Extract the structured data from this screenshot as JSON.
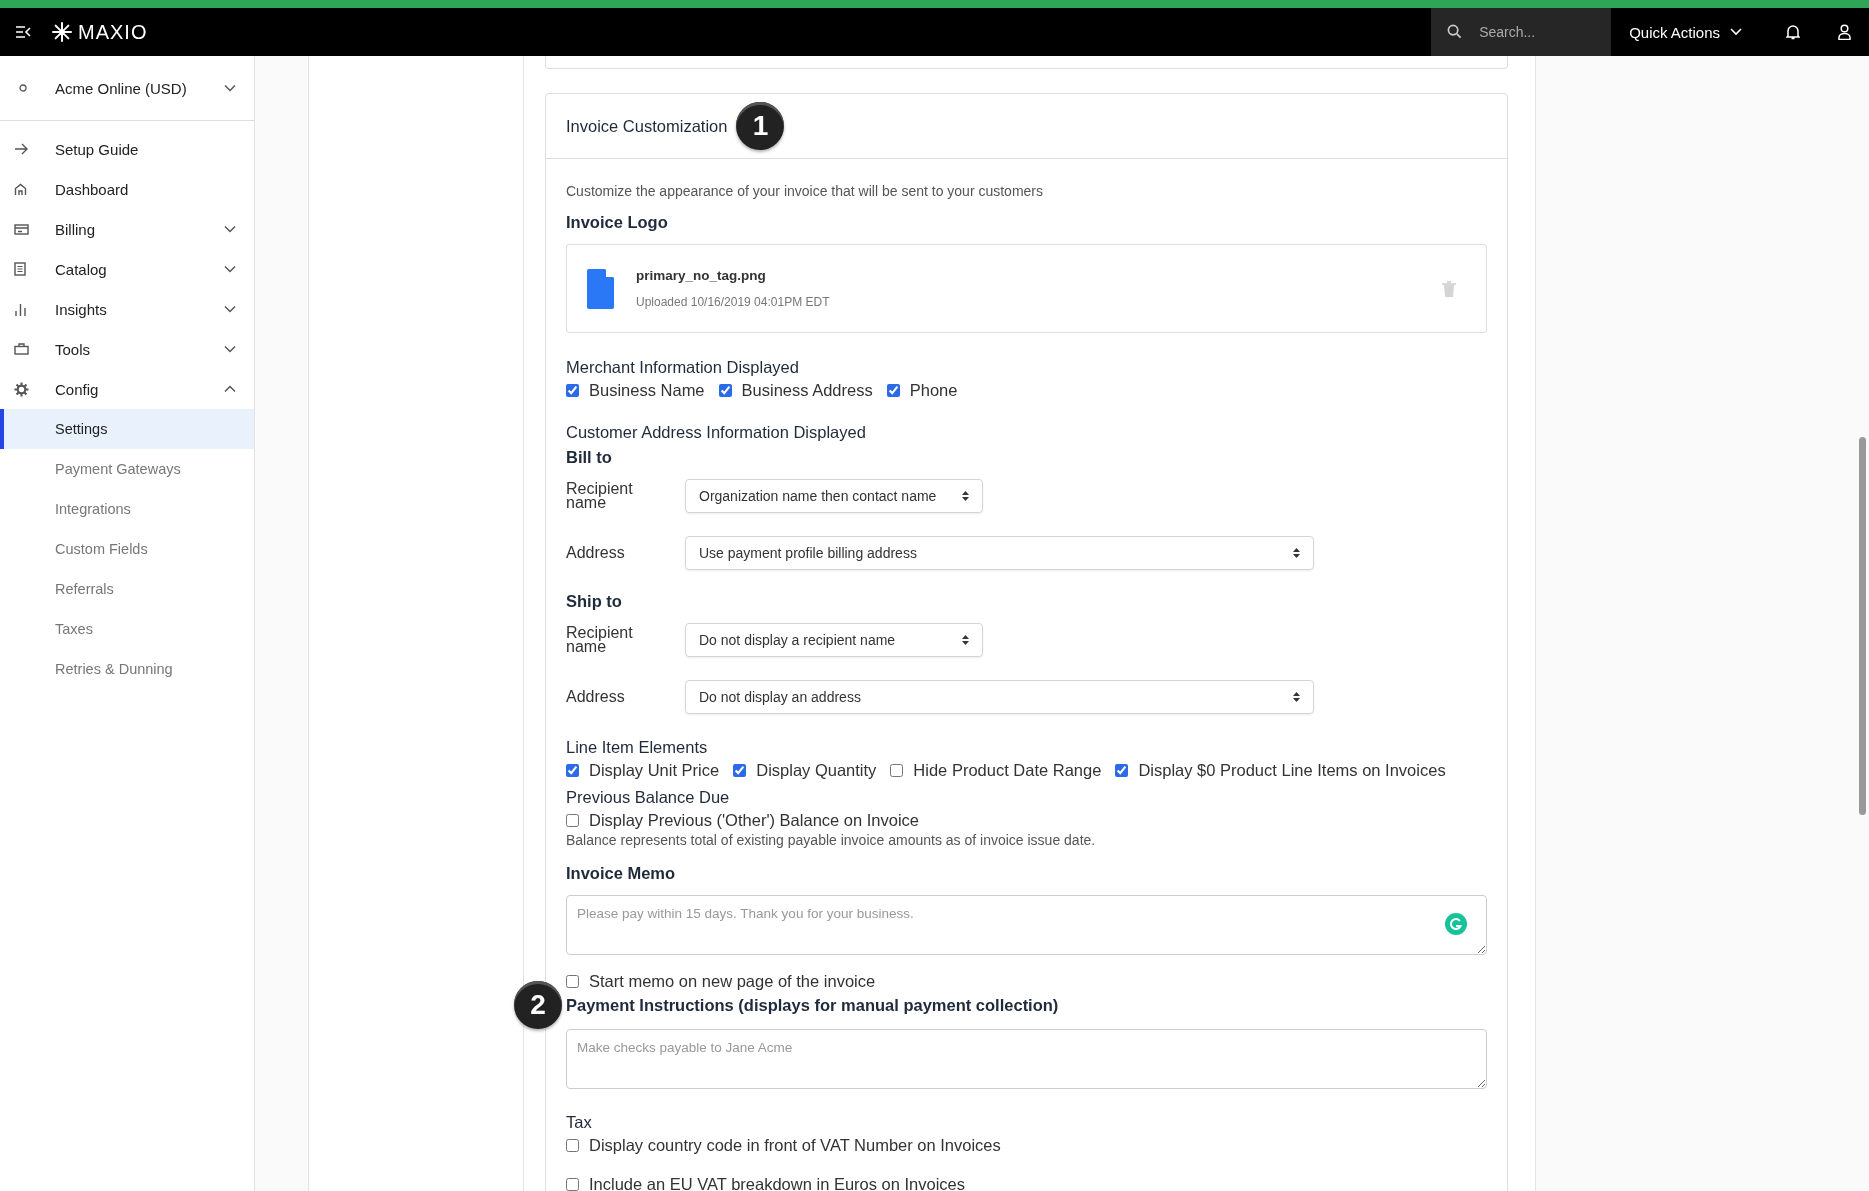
{
  "top_bar": {
    "logo": "MAXIO",
    "search": {
      "placeholder": "Search..."
    },
    "quick_actions": "Quick Actions"
  },
  "sidebar": {
    "account": "Acme Online (USD)",
    "items": [
      {
        "label": "Setup Guide"
      },
      {
        "label": "Dashboard"
      },
      {
        "label": "Billing",
        "expanded": false
      },
      {
        "label": "Catalog",
        "expanded": false
      },
      {
        "label": "Insights",
        "expanded": false
      },
      {
        "label": "Tools",
        "expanded": false
      },
      {
        "label": "Config",
        "expanded": true,
        "children": [
          {
            "label": "Settings",
            "selected": true
          },
          {
            "label": "Payment Gateways",
            "selected": false
          },
          {
            "label": "Integrations",
            "selected": false
          },
          {
            "label": "Custom Fields",
            "selected": false
          },
          {
            "label": "Referrals",
            "selected": false
          },
          {
            "label": "Taxes",
            "selected": false
          },
          {
            "label": "Retries & Dunning",
            "selected": false
          }
        ]
      }
    ]
  },
  "card": {
    "title": "Invoice Customization",
    "annotation": "1",
    "description": "Customize the appearance of your invoice that will be sent to your customers",
    "logo": {
      "heading": "Invoice Logo",
      "file_name": "primary_no_tag.png",
      "uploaded": "Uploaded 10/16/2019 04:01PM EDT"
    },
    "merchant": {
      "heading": "Merchant Information Displayed",
      "options": [
        {
          "label": "Business Name",
          "checked": true
        },
        {
          "label": "Business Address",
          "checked": true
        },
        {
          "label": "Phone",
          "checked": true
        }
      ]
    },
    "customer_address": {
      "heading": "Customer Address Information Displayed",
      "groups": [
        {
          "heading": "Bill to",
          "fields": [
            {
              "label": "Recipient name",
              "value": "Organization name then contact name"
            },
            {
              "label": "Address",
              "value": "Use payment profile billing address"
            }
          ]
        },
        {
          "heading": "Ship to",
          "fields": [
            {
              "label": "Recipient name",
              "value": "Do not display a recipient name"
            },
            {
              "label": "Address",
              "value": "Do not display an address"
            }
          ]
        }
      ]
    },
    "line_items": {
      "heading": "Line Item Elements",
      "options": [
        {
          "label": "Display Unit Price",
          "checked": true
        },
        {
          "label": "Display Quantity",
          "checked": true
        },
        {
          "label": "Hide Product Date Range",
          "checked": false
        },
        {
          "label": "Display $0 Product Line Items on Invoices",
          "checked": true
        }
      ]
    },
    "previous_balance": {
      "heading": "Previous Balance Due",
      "options": [
        {
          "label": "Display Previous ('Other') Balance on Invoice",
          "checked": false
        }
      ],
      "note": "Balance represents total of existing payable invoice amounts as of invoice issue date."
    },
    "memo": {
      "heading": "Invoice Memo",
      "placeholder": "Please pay within 15 days. Thank you for your business.",
      "option": {
        "label": "Start memo on new page of the invoice",
        "checked": false
      }
    },
    "payment_instructions": {
      "heading": "Payment Instructions (displays for manual payment collection)",
      "annotation": "2",
      "placeholder": "Make checks payable to Jane Acme"
    },
    "tax": {
      "heading": "Tax",
      "options": [
        {
          "label": "Display country code in front of VAT Number on Invoices",
          "checked": false
        },
        {
          "label": "Include an EU VAT breakdown in Euros on Invoices",
          "checked": false
        }
      ]
    }
  }
}
